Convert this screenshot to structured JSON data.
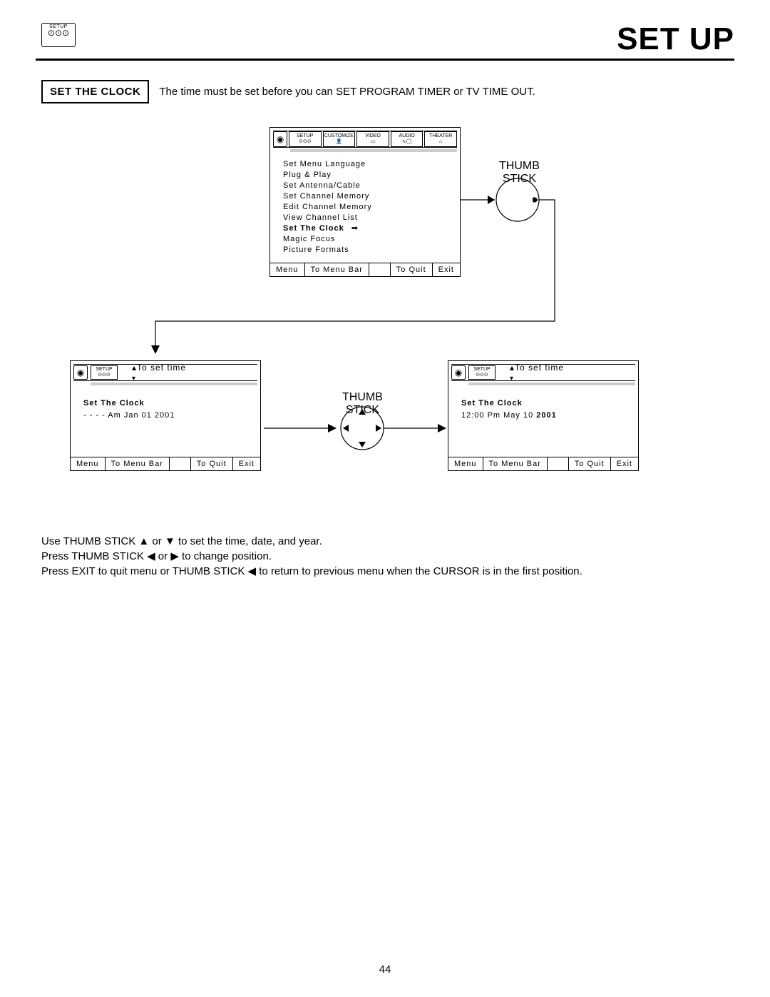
{
  "header": {
    "page_title": "SET UP",
    "icon_label": "SETUP"
  },
  "intro": {
    "box_label": "SET THE CLOCK",
    "text": "The time must be set before you can  SET PROGRAM TIMER or TV TIME OUT."
  },
  "thumbstick_label": "THUMB\nSTICK",
  "menubar_tabs": [
    "SETUP",
    "CUSTOMIZE",
    "VIDEO",
    "AUDIO",
    "THEATER"
  ],
  "main_menu": {
    "items": [
      "Set Menu Language",
      "Plug & Play",
      "Set Antenna/Cable",
      "Set Channel Memory",
      "Edit Channel Memory",
      "View Channel List",
      "Set The Clock",
      "Magic Focus",
      "Picture Formats"
    ],
    "selected_index": 6
  },
  "footer": {
    "menu": "Menu",
    "to_menu_bar": "To Menu Bar",
    "to_quit": "To Quit",
    "exit": "Exit"
  },
  "clock_header": "To set time",
  "clock_left": {
    "title": "Set The Clock",
    "value": "- -  - - Am Jan 01 2001"
  },
  "clock_right": {
    "title": "Set The Clock",
    "value_prefix": "12:00 Pm May 10 ",
    "value_bold": "2001"
  },
  "instructions": {
    "line1_a": "Use THUMB STICK ",
    "line1_b": " or ",
    "line1_c": " to set the time, date, and year.",
    "line2_a": "Press THUMB STICK ",
    "line2_b": " or ",
    "line2_c": " to change position.",
    "line3_a": "Press EXIT to quit menu or THUMB STICK ",
    "line3_b": " to return to previous menu when the CURSOR is in the first position."
  },
  "page_number": "44"
}
